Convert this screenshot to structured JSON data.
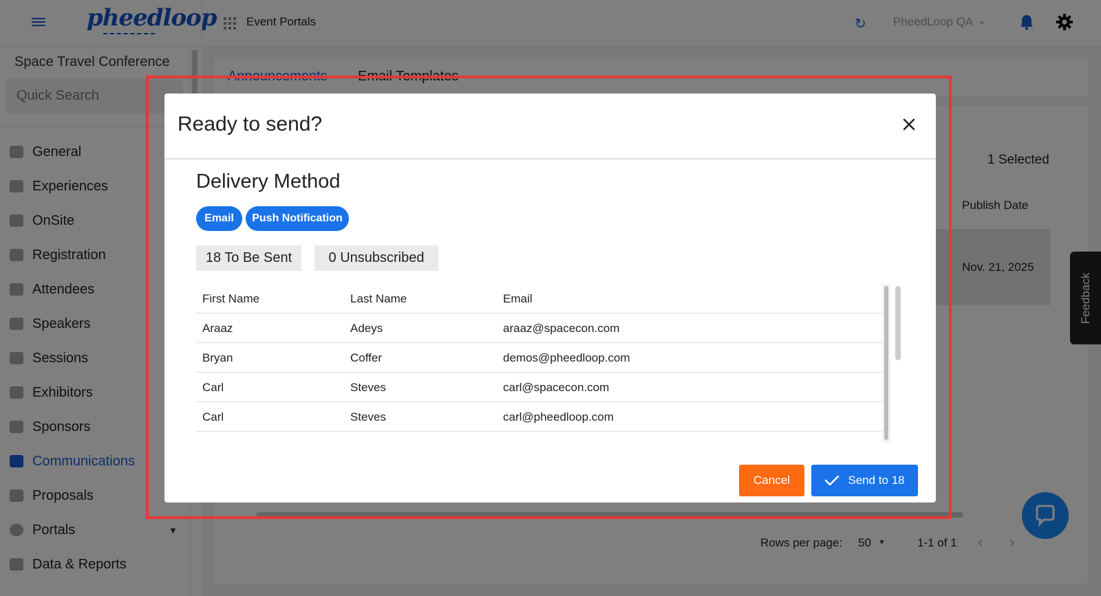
{
  "app": {
    "logo_text": "pheedloop",
    "nav_portals_label": "Event Portals",
    "org_select": "PheedLoop QA"
  },
  "sidebar": {
    "event_name": "Space Travel Conference",
    "search_placeholder": "Quick Search",
    "items": [
      {
        "label": "General"
      },
      {
        "label": "Experiences"
      },
      {
        "label": "OnSite"
      },
      {
        "label": "Registration"
      },
      {
        "label": "Attendees"
      },
      {
        "label": "Speakers"
      },
      {
        "label": "Sessions"
      },
      {
        "label": "Exhibitors"
      },
      {
        "label": "Sponsors"
      },
      {
        "label": "Communications"
      },
      {
        "label": "Proposals"
      },
      {
        "label": "Portals"
      },
      {
        "label": "Data & Reports"
      }
    ]
  },
  "main": {
    "tabs": [
      {
        "label": "Announcements"
      },
      {
        "label": "Email Templates"
      }
    ],
    "selected_count": "1 Selected",
    "column_publish_date": "Publish Date",
    "row_publish_date": "Nov. 21, 2025",
    "pagination": {
      "rows_per_page_label": "Rows per page:",
      "rows_per_page_value": "50",
      "range": "1-1 of 1"
    }
  },
  "feedback_label": "Feedback",
  "modal": {
    "title": "Ready to send?",
    "delivery_title": "Delivery Method",
    "methods": [
      {
        "label": "Email"
      },
      {
        "label": "Push Notification"
      }
    ],
    "to_be_sent": "18 To Be Sent",
    "unsubscribed": "0 Unsubscribed",
    "table": {
      "headers": [
        "First Name",
        "Last Name",
        "Email"
      ],
      "rows": [
        [
          "Araaz",
          "Adeys",
          "araaz@spacecon.com"
        ],
        [
          "Bryan",
          "Coffer",
          "demos@pheedloop.com"
        ],
        [
          "Carl",
          "Steves",
          "carl@spacecon.com"
        ],
        [
          "Carl",
          "Steves",
          "carl@pheedloop.com"
        ]
      ]
    },
    "cancel_label": "Cancel",
    "send_label": "Send to 18"
  },
  "colors": {
    "accent": "#1a73e8",
    "cancel": "#ff6a13",
    "highlight": "#e53935"
  }
}
